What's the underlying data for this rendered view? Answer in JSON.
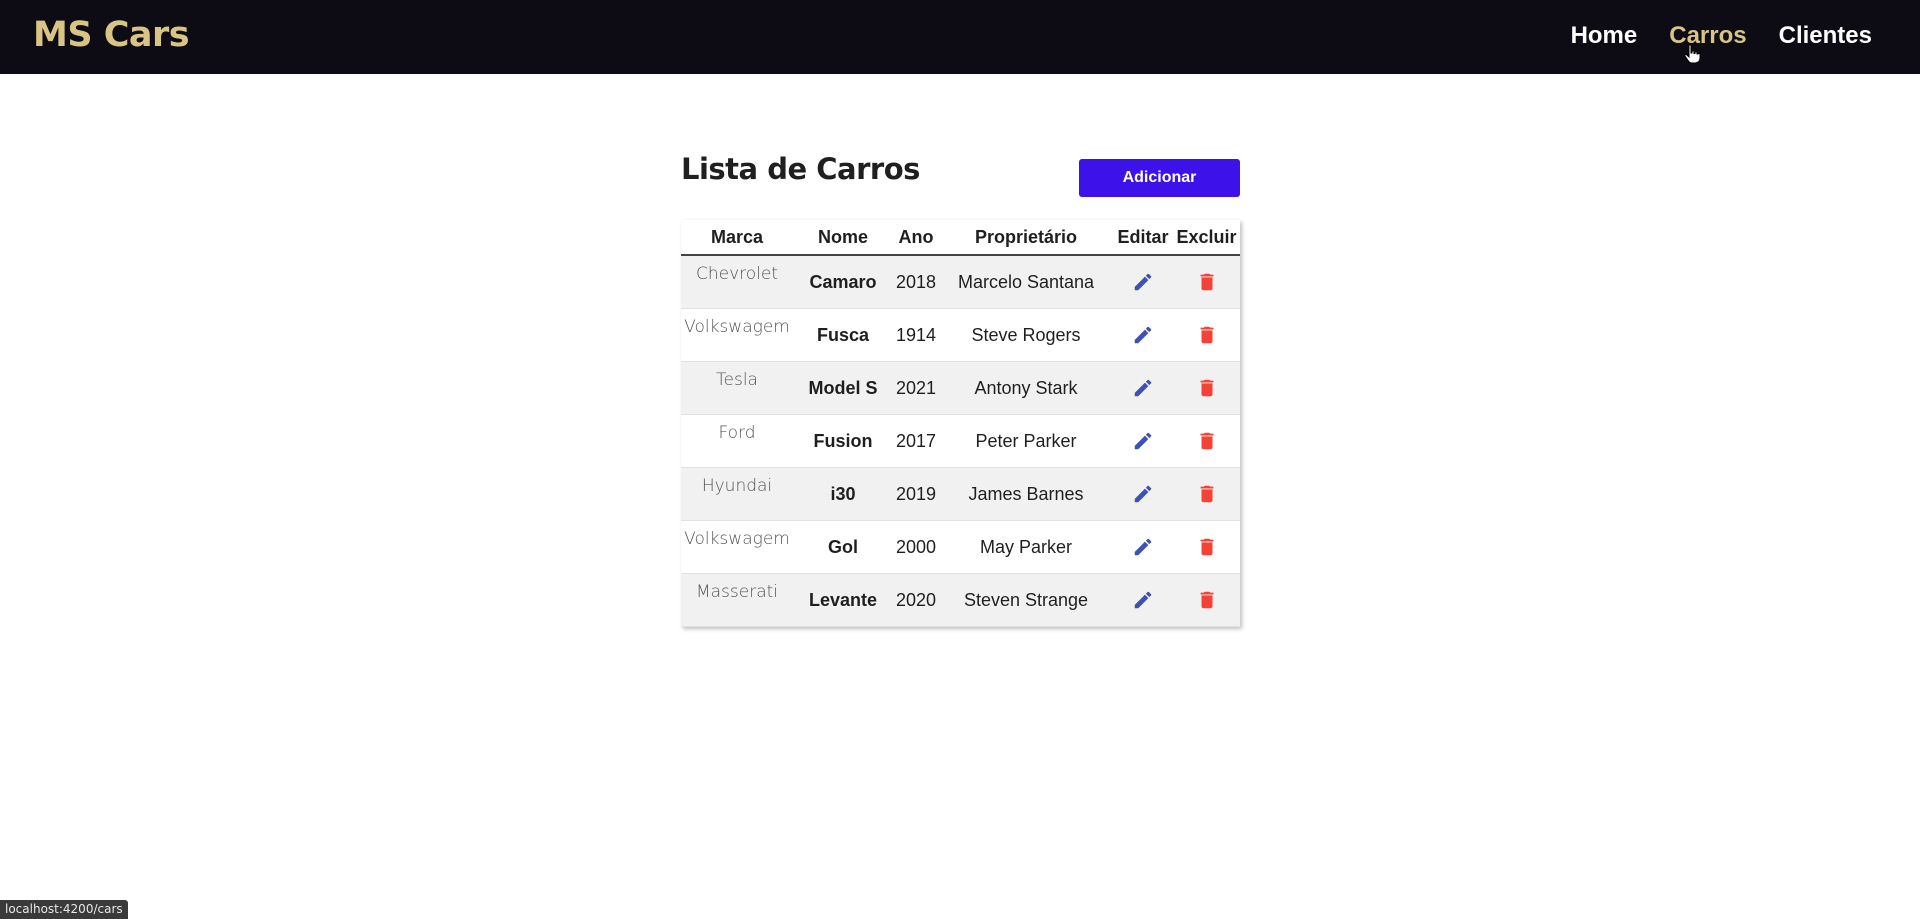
{
  "app": {
    "brand": "MS Cars"
  },
  "nav": [
    {
      "label": "Home",
      "active": false
    },
    {
      "label": "Carros",
      "active": true
    },
    {
      "label": "Clientes",
      "active": false
    }
  ],
  "page": {
    "title": "Lista de Carros",
    "add_label": "Adicionar"
  },
  "table": {
    "headers": [
      "Marca",
      "Nome",
      "Ano",
      "Proprietário",
      "Editar",
      "Excluir"
    ],
    "rows": [
      {
        "marca": "Chevrolet",
        "nome": "Camaro",
        "ano": "2018",
        "proprietario": "Marcelo Santana"
      },
      {
        "marca": "Volkswagem",
        "nome": "Fusca",
        "ano": "1914",
        "proprietario": "Steve Rogers"
      },
      {
        "marca": "Tesla",
        "nome": "Model S",
        "ano": "2021",
        "proprietario": "Antony Stark"
      },
      {
        "marca": "Ford",
        "nome": "Fusion",
        "ano": "2017",
        "proprietario": "Peter Parker"
      },
      {
        "marca": "Hyundai",
        "nome": "i30",
        "ano": "2019",
        "proprietario": "James Barnes"
      },
      {
        "marca": "Volkswagem",
        "nome": "Gol",
        "ano": "2000",
        "proprietario": "May Parker"
      },
      {
        "marca": "Masserati",
        "nome": "Levante",
        "ano": "2020",
        "proprietario": "Steven Strange"
      }
    ],
    "edit_icon": "pencil-icon",
    "delete_icon": "trash-icon"
  },
  "status": {
    "url": "localhost:4200/cars"
  },
  "colors": {
    "nav_bg": "#0d0b14",
    "brand": "#d8c585",
    "accent": "#3d12ea",
    "edit": "#3f51b5",
    "delete": "#f44336"
  }
}
